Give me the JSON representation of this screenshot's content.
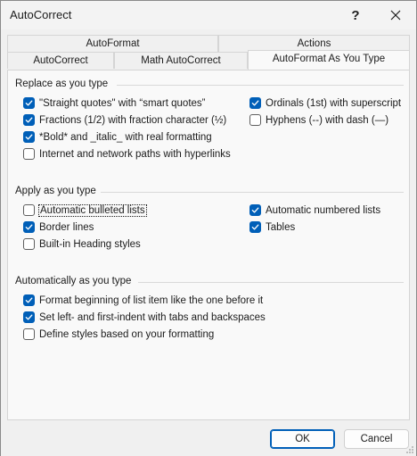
{
  "window": {
    "title": "AutoCorrect",
    "help_glyph": "?",
    "close_icon": "close-icon"
  },
  "tabs": {
    "row_back": [
      "AutoFormat",
      "Actions"
    ],
    "row_front": [
      "AutoCorrect",
      "Math AutoCorrect",
      "AutoFormat As You Type"
    ],
    "active": "AutoFormat As You Type"
  },
  "groups": {
    "replace": {
      "title": "Replace as you type",
      "options": [
        {
          "label": "\"Straight quotes\" with “smart quotes”",
          "checked": true
        },
        {
          "label": "Ordinals (1st) with superscript",
          "checked": true
        },
        {
          "label": "Fractions (1/2) with fraction character (½)",
          "checked": true
        },
        {
          "label": "Hyphens (--) with dash (—)",
          "checked": false
        },
        {
          "label": "*Bold* and _italic_ with real formatting",
          "checked": true
        },
        {
          "label": "Internet and network paths with hyperlinks",
          "checked": false
        }
      ]
    },
    "apply": {
      "title": "Apply as you type",
      "options": [
        {
          "label": "Automatic bulleted lists",
          "checked": false,
          "focused": true
        },
        {
          "label": "Automatic numbered lists",
          "checked": true
        },
        {
          "label": "Border lines",
          "checked": true
        },
        {
          "label": "Tables",
          "checked": true
        },
        {
          "label": "Built-in Heading styles",
          "checked": false
        }
      ]
    },
    "auto": {
      "title": "Automatically as you type",
      "options": [
        {
          "label": "Format beginning of list item like the one before it",
          "checked": true
        },
        {
          "label": "Set left- and first-indent with tabs and backspaces",
          "checked": true
        },
        {
          "label": "Define styles based on your formatting",
          "checked": false
        }
      ]
    }
  },
  "buttons": {
    "ok": "OK",
    "cancel": "Cancel"
  },
  "colors": {
    "accent": "#005fb8"
  }
}
